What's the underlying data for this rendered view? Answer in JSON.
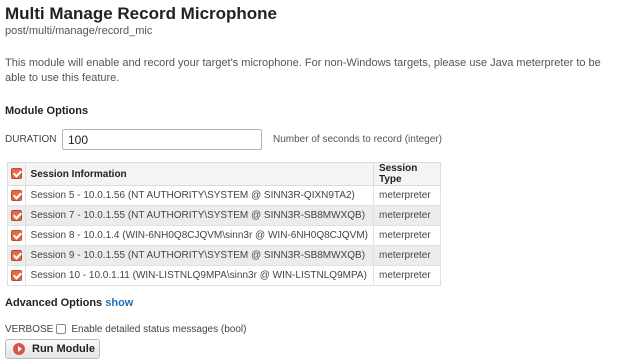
{
  "header": {
    "title": "Multi Manage Record Microphone",
    "path": "post/multi/manage/record_mic",
    "description": "This module will enable and record your target's microphone. For non-Windows targets, please use Java meterpreter to be able to use this feature."
  },
  "module_options": {
    "heading": "Module Options",
    "duration": {
      "label": "DURATION",
      "value": "100",
      "hint": "Number of seconds to record (integer)"
    }
  },
  "sessions": {
    "columns": [
      "Session Information",
      "Session Type"
    ],
    "rows": [
      {
        "info": "Session 5 - 10.0.1.56 (NT AUTHORITY\\SYSTEM @ SINN3R-QIXN9TA2)",
        "type": "meterpreter",
        "checked": true
      },
      {
        "info": "Session 7 - 10.0.1.55 (NT AUTHORITY\\SYSTEM @ SINN3R-SB8MWXQB)",
        "type": "meterpreter",
        "checked": true
      },
      {
        "info": "Session 8 - 10.0.1.4 (WIN-6NH0Q8CJQVM\\sinn3r @ WIN-6NH0Q8CJQVM)",
        "type": "meterpreter",
        "checked": true
      },
      {
        "info": "Session 9 - 10.0.1.55 (NT AUTHORITY\\SYSTEM @ SINN3R-SB8MWXQB)",
        "type": "meterpreter",
        "checked": true
      },
      {
        "info": "Session 10 - 10.0.1.11 (WIN-LISTNLQ9MPA\\sinn3r @ WIN-LISTNLQ9MPA)",
        "type": "meterpreter",
        "checked": true
      }
    ]
  },
  "advanced": {
    "heading": "Advanced Options",
    "show_label": "show",
    "verbose_label": "VERBOSE",
    "verbose_desc": "Enable detailed status messages (bool)",
    "verbose_checked": false
  },
  "actions": {
    "run_label": "Run Module"
  },
  "colors": {
    "accent_checkbox": "#e26b4a",
    "link": "#1f6fb2",
    "run_icon": "#d9534f"
  },
  "icons": {
    "checkbox": "checkbox-checked-icon",
    "run": "run-module-icon"
  }
}
